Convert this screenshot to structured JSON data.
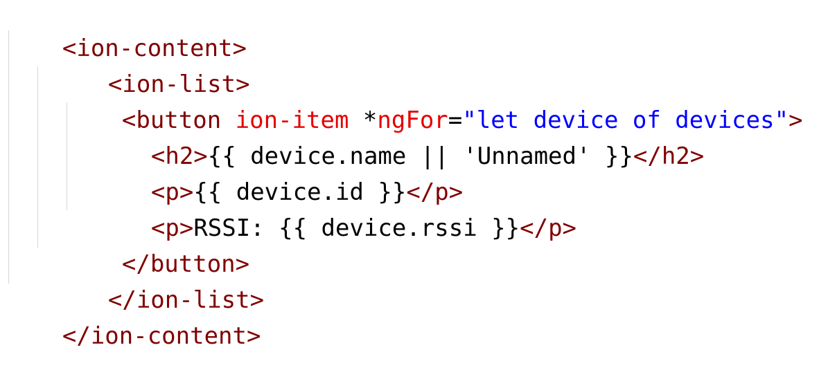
{
  "code": {
    "line1": {
      "open": "<ion-content>"
    },
    "line2": {
      "open": "<ion-list>"
    },
    "line3": {
      "open": "<button",
      "attr1": "ion-item",
      "attr2_prefix": "*",
      "attr2": "ngFor",
      "equals": "=",
      "value": "\"let device of devices\"",
      "close": ">"
    },
    "line4": {
      "open": "<h2>",
      "text": "{{ device.name || 'Unnamed' }}",
      "close": "</h2>"
    },
    "line5": {
      "open": "<p>",
      "text": "{{ device.id }}",
      "close": "</p>"
    },
    "line6": {
      "open": "<p>",
      "text": "RSSI: {{ device.rssi }}",
      "close": "</p>"
    },
    "line7": {
      "close": "</button>"
    },
    "line8": {
      "close": "</ion-list>"
    },
    "line9": {
      "close": "</ion-content>"
    }
  },
  "colors": {
    "tag": "#800000",
    "attribute": "#e50000",
    "string": "#0000ff",
    "text": "#000000",
    "indent_guide": "#d6d6d6"
  }
}
